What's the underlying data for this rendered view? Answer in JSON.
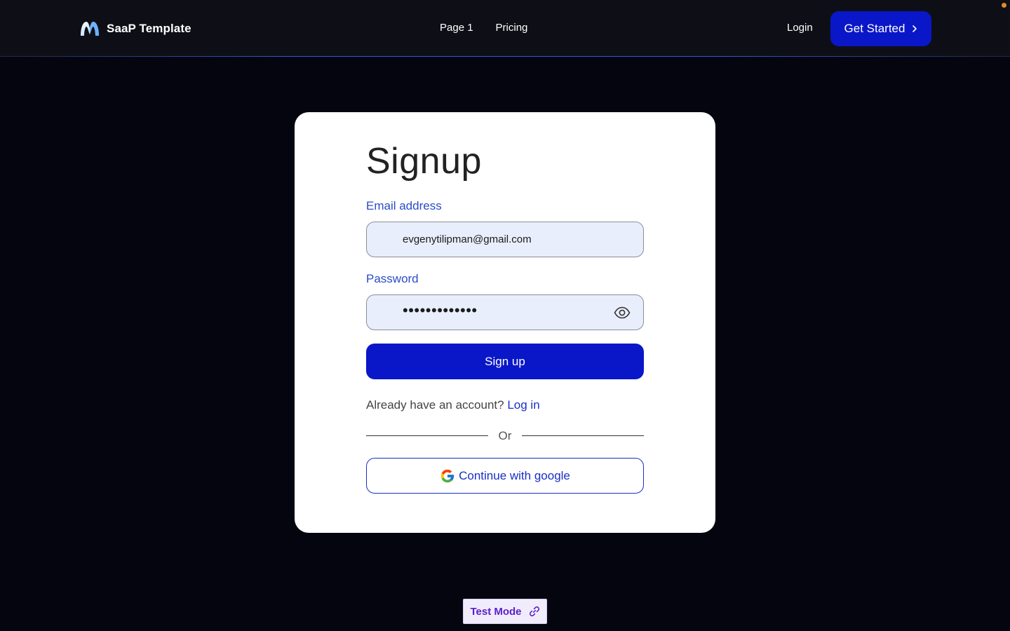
{
  "header": {
    "brand_name": "SaaP Template",
    "brand_icon": "m-logo-icon",
    "nav": [
      {
        "label": "Page 1"
      },
      {
        "label": "Pricing"
      }
    ],
    "login_label": "Login",
    "cta_label": "Get Started",
    "cta_icon": "chevron-right-icon"
  },
  "signup": {
    "title": "Signup",
    "email_label": "Email address",
    "email_value": "evgenytilipman@gmail.com",
    "password_label": "Password",
    "password_masked": "•••••••••••••",
    "password_toggle_icon": "eye-icon",
    "submit_label": "Sign up",
    "already_text": "Already have an account?",
    "login_link": "Log in",
    "divider_text": "Or",
    "google_label": "Continue with google",
    "google_icon": "google-icon"
  },
  "footer": {
    "test_mode_label": "Test Mode",
    "test_mode_icon": "link-icon"
  },
  "colors": {
    "page_bg": "#05050f",
    "header_bg": "#0e0f16",
    "primary": "#0a17c8",
    "field_bg": "#e9eefc",
    "label": "#2a4cc7",
    "test_mode_text": "#5a1fc9"
  }
}
